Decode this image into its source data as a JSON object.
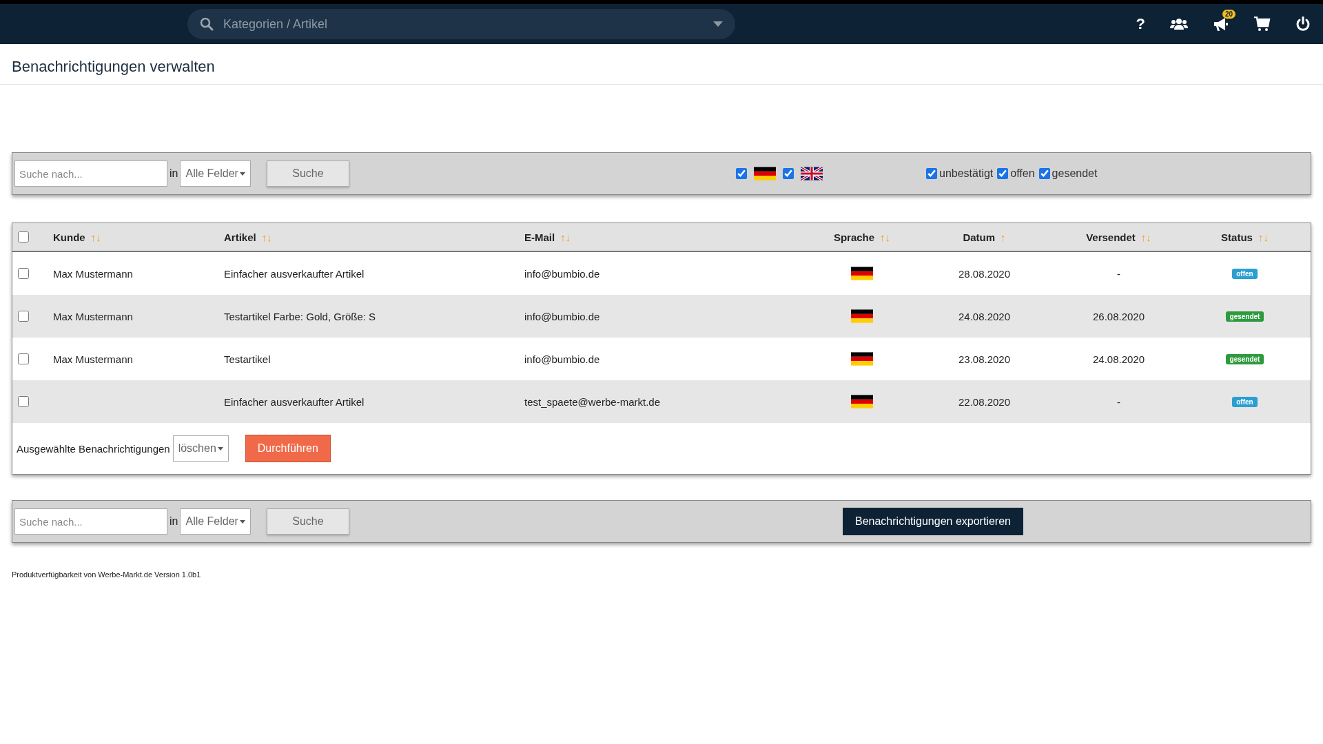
{
  "topbar": {
    "search": {
      "placeholder": "Kategorien / Artikel"
    },
    "help_label": "?",
    "notification_count": "20"
  },
  "page_title": "Benachrichtigungen verwalten",
  "filter_bar": {
    "search": {
      "placeholder": "Suche nach..."
    },
    "in_label": "in",
    "field_select": "Alle Felder",
    "search_button": "Suche",
    "languages": [
      {
        "kind": "de",
        "checked": true
      },
      {
        "kind": "en",
        "checked": true
      }
    ],
    "statuses": [
      {
        "label": "unbestätigt",
        "checked": true
      },
      {
        "label": "offen",
        "checked": true
      },
      {
        "label": "gesendet",
        "checked": true
      }
    ]
  },
  "table": {
    "select_all_checked": false,
    "columns": [
      {
        "label": "Kunde",
        "sort": "↑↓"
      },
      {
        "label": "Artikel",
        "sort": "↑↓"
      },
      {
        "label": "E-Mail",
        "sort": "↑↓"
      },
      {
        "label": "Sprache",
        "sort": "↑↓"
      },
      {
        "label": "Datum",
        "sort": "↑"
      },
      {
        "label": "Versendet",
        "sort": "↑↓"
      },
      {
        "label": "Status",
        "sort": "↑↓"
      }
    ],
    "rows": [
      {
        "checked": false,
        "customer": "Max Mustermann",
        "article": "Einfacher ausverkaufter Artikel",
        "email": "info@bumbio.de",
        "flag": {
          "kind": "de"
        },
        "date": "28.08.2020",
        "sent": "-",
        "status": {
          "text": "offen",
          "color": "#2b9fd0"
        }
      },
      {
        "checked": false,
        "customer": "Max Mustermann",
        "article": "Testartikel Farbe: Gold, Größe: S",
        "email": "info@bumbio.de",
        "flag": {
          "kind": "de"
        },
        "date": "24.08.2020",
        "sent": "26.08.2020",
        "status": {
          "text": "gesendet",
          "color": "#2e9a3e"
        }
      },
      {
        "checked": false,
        "customer": "Max Mustermann",
        "article": "Testartikel",
        "email": "info@bumbio.de",
        "flag": {
          "kind": "de"
        },
        "date": "23.08.2020",
        "sent": "24.08.2020",
        "status": {
          "text": "gesendet",
          "color": "#2e9a3e"
        }
      },
      {
        "checked": false,
        "article": "Einfacher ausverkaufter Artikel",
        "email": "test_spaete@werbe-markt.de",
        "flag": {
          "kind": "de"
        },
        "date": "22.08.2020",
        "sent": "-",
        "status": {
          "text": "offen",
          "color": "#2b9fd0"
        }
      }
    ],
    "bulk": {
      "label": "Ausgewählte Benachrichtigungen",
      "action": "löschen",
      "button": "Durchführen"
    }
  },
  "bottom_bar": {
    "search": {
      "placeholder": "Suche nach..."
    },
    "in_label": "in",
    "field_select": "Alle Felder",
    "search_button": "Suche",
    "export_button": "Benachrichtigungen exportieren"
  },
  "footer": "Produktverfügbarkeit von Werbe-Markt.de Version 1.0b1"
}
